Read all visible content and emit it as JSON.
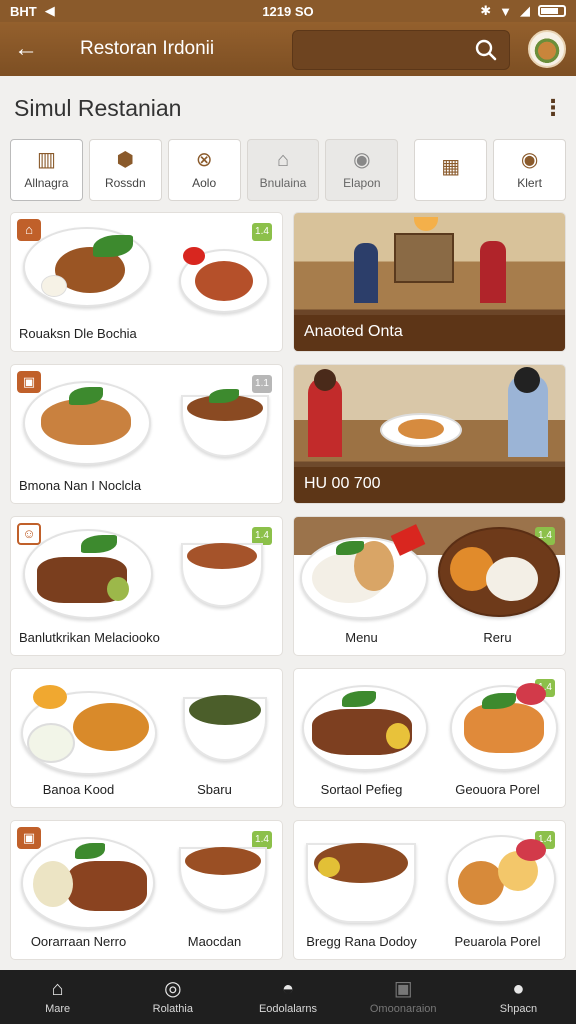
{
  "status": {
    "carrier": "BHT",
    "time": "1219 SO",
    "battery_level": 0.7
  },
  "app_bar": {
    "title": "Restoran Irdonii",
    "search_placeholder": ""
  },
  "page": {
    "title": "Simul Restanian"
  },
  "categories": [
    {
      "label": "Allnagra",
      "icon": "building-icon"
    },
    {
      "label": "Rossdn",
      "icon": "food-icon"
    },
    {
      "label": "Aolo",
      "icon": "cutlery-icon"
    },
    {
      "label": "Bnulaina",
      "icon": "store-icon"
    },
    {
      "label": "Elapon",
      "icon": "search-place-icon"
    },
    {
      "label": "",
      "icon": "columns-icon"
    },
    {
      "label": "Klert",
      "icon": "location-icon"
    }
  ],
  "cards": [
    {
      "label": "Rouaksn Dle Bochia",
      "type": "dish"
    },
    {
      "label": "Anaoted Onta",
      "type": "photo"
    },
    {
      "label": "Bmona Nan I Noclcla",
      "type": "dish"
    },
    {
      "label": "HU 00 700",
      "type": "photo"
    },
    {
      "label": "Banlutkrikan Melaciooko",
      "type": "dish"
    },
    {
      "label": "Menu",
      "type": "dish"
    },
    {
      "label": "Reru",
      "type": "dish"
    },
    {
      "label": "Banoa Kood",
      "type": "dish"
    },
    {
      "label": "Sbaru",
      "type": "dish"
    },
    {
      "label": "Sortaol Pefieg",
      "type": "dish"
    },
    {
      "label": "Geouora Porel",
      "type": "dish"
    },
    {
      "label": "Oorarraan Nerro",
      "type": "dish"
    },
    {
      "label": "Maocdan",
      "type": "dish"
    },
    {
      "label": "Bregg Rana Dodoy",
      "type": "dish"
    },
    {
      "label": "Peuarola Porel",
      "type": "dish"
    }
  ],
  "tabs": [
    {
      "label": "Mare",
      "icon": "home-icon"
    },
    {
      "label": "Rolathia",
      "icon": "search-icon"
    },
    {
      "label": "Eodolalarns",
      "icon": "chat-icon"
    },
    {
      "label": "Omoonaraion",
      "icon": "image-icon"
    },
    {
      "label": "Shpacn",
      "icon": "profile-icon"
    }
  ],
  "colors": {
    "brand": "#8a5a2b",
    "badge_green": "#8cc04a",
    "badge_orange": "#c0602a"
  }
}
